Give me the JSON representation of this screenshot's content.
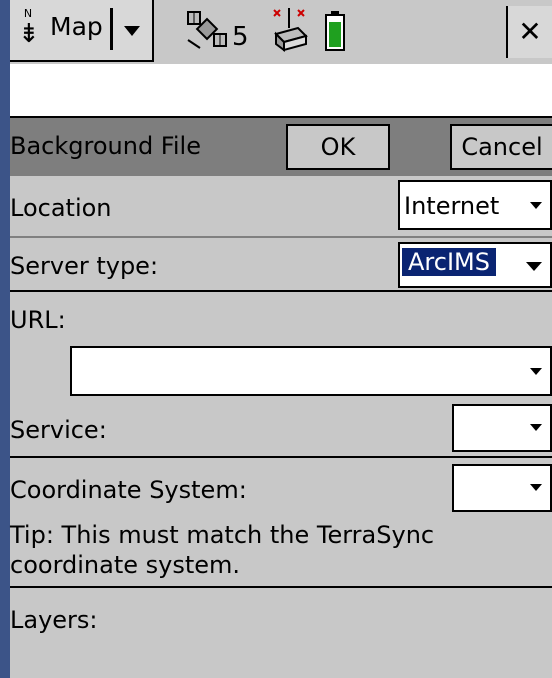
{
  "toolbar": {
    "north_label": "N",
    "section_label": "Map",
    "satellite_count": "5",
    "close_glyph": "✕"
  },
  "form": {
    "title": "Background File",
    "ok_label": "OK",
    "cancel_label": "Cancel",
    "location": {
      "label": "Location",
      "value": "Internet"
    },
    "server_type": {
      "label": "Server type:",
      "value": "ArcIMS"
    },
    "url": {
      "label": "URL:",
      "value": ""
    },
    "service": {
      "label": "Service:",
      "value": ""
    },
    "coordinate_system": {
      "label": "Coordinate System:",
      "value": ""
    },
    "tip": "Tip: This must match the TerraSync coordinate system.",
    "layers_label": "Layers:"
  },
  "colors": {
    "frame": "#3c5488",
    "header_bar": "#7e7e7e",
    "selection": "#0a2472",
    "battery": "#1fa01f"
  }
}
